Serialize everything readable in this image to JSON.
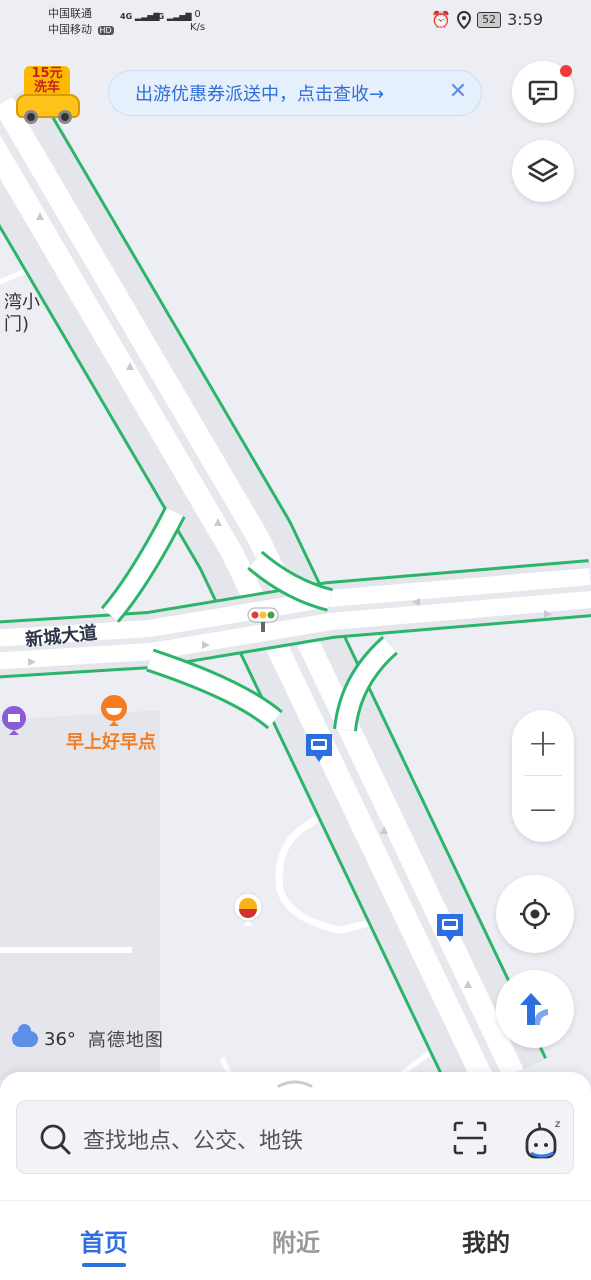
{
  "status_bar": {
    "carrier1": "中国联通",
    "carrier2": "中国移动",
    "hd": "HD",
    "net": "4G",
    "speed_value": "0",
    "speed_unit": "K/s",
    "battery": "52",
    "time": "3:59"
  },
  "promo": {
    "carwash_price": "15元",
    "carwash_label": "洗车",
    "banner_text": "出游优惠券派送中，点击查收→",
    "close_glyph": "✕"
  },
  "map": {
    "road_name": "新城大道",
    "poi_partial_line1": "湾小",
    "poi_partial_line2": "门)",
    "poi_breakfast": "早上好早点",
    "colors": {
      "road_green": "#2BB56B",
      "poi_orange": "#F57C20",
      "bus_blue": "#2C6FE0",
      "shop_purple": "#8A5CD6"
    }
  },
  "controls": {
    "zoom_in": "+",
    "zoom_out": "−",
    "icons": [
      "message-icon",
      "layers-icon",
      "locate-icon",
      "navigation-icon"
    ]
  },
  "weather": {
    "temp": "36°",
    "brand": "高德地图"
  },
  "bottom": {
    "search_placeholder": "查找地点、公交、地铁",
    "tabs": [
      {
        "label": "首页",
        "active": true
      },
      {
        "label": "附近",
        "active": false
      },
      {
        "label": "我的",
        "active": false
      }
    ]
  }
}
